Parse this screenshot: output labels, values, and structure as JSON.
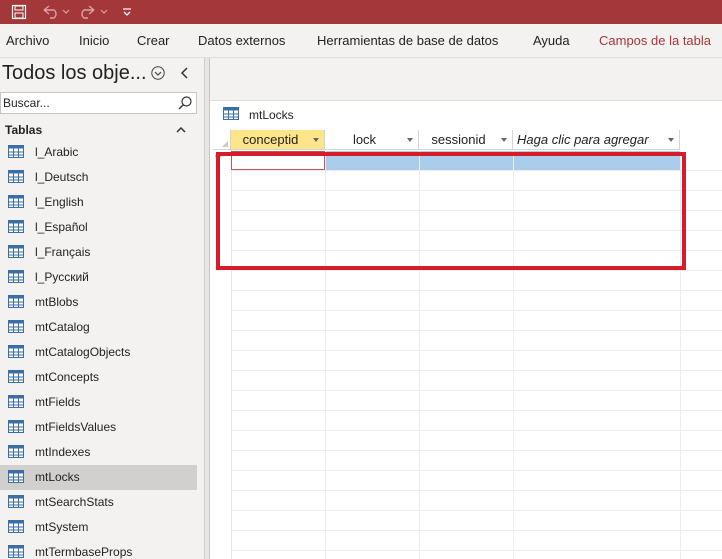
{
  "quick_access": {
    "save_icon": "save-icon",
    "undo_icon": "undo-icon",
    "redo_icon": "redo-icon",
    "customize_icon": "customize-quick-access-icon"
  },
  "colors": {
    "title_bar": "#a4373a",
    "contextual_tab": "#a4373a",
    "active_header": "#fde589",
    "new_row": "#a9cdea",
    "highlight_box": "#d41c2b"
  },
  "ribbon": {
    "tabs": [
      "Archivo",
      "Inicio",
      "Crear",
      "Datos externos",
      "Herramientas de base de datos",
      "Ayuda",
      "Campos de la tabla"
    ]
  },
  "nav": {
    "title": "Todos los obje...",
    "search_placeholder": "Buscar...",
    "group": "Tablas",
    "items": [
      "l_Arabic",
      "l_Deutsch",
      "l_English",
      "l_Español",
      "l_Français",
      "l_Русский",
      "mtBlobs",
      "mtCatalog",
      "mtCatalogObjects",
      "mtConcepts",
      "mtFields",
      "mtFieldsValues",
      "mtIndexes",
      "mtLocks",
      "mtSearchStats",
      "mtSystem",
      "mtTermbaseProps"
    ],
    "selected": "mtLocks"
  },
  "document": {
    "tab_label": "mtLocks",
    "columns": [
      "conceptid",
      "lock",
      "sessionid",
      "Haga clic para agregar"
    ],
    "new_record_marker": "*"
  }
}
